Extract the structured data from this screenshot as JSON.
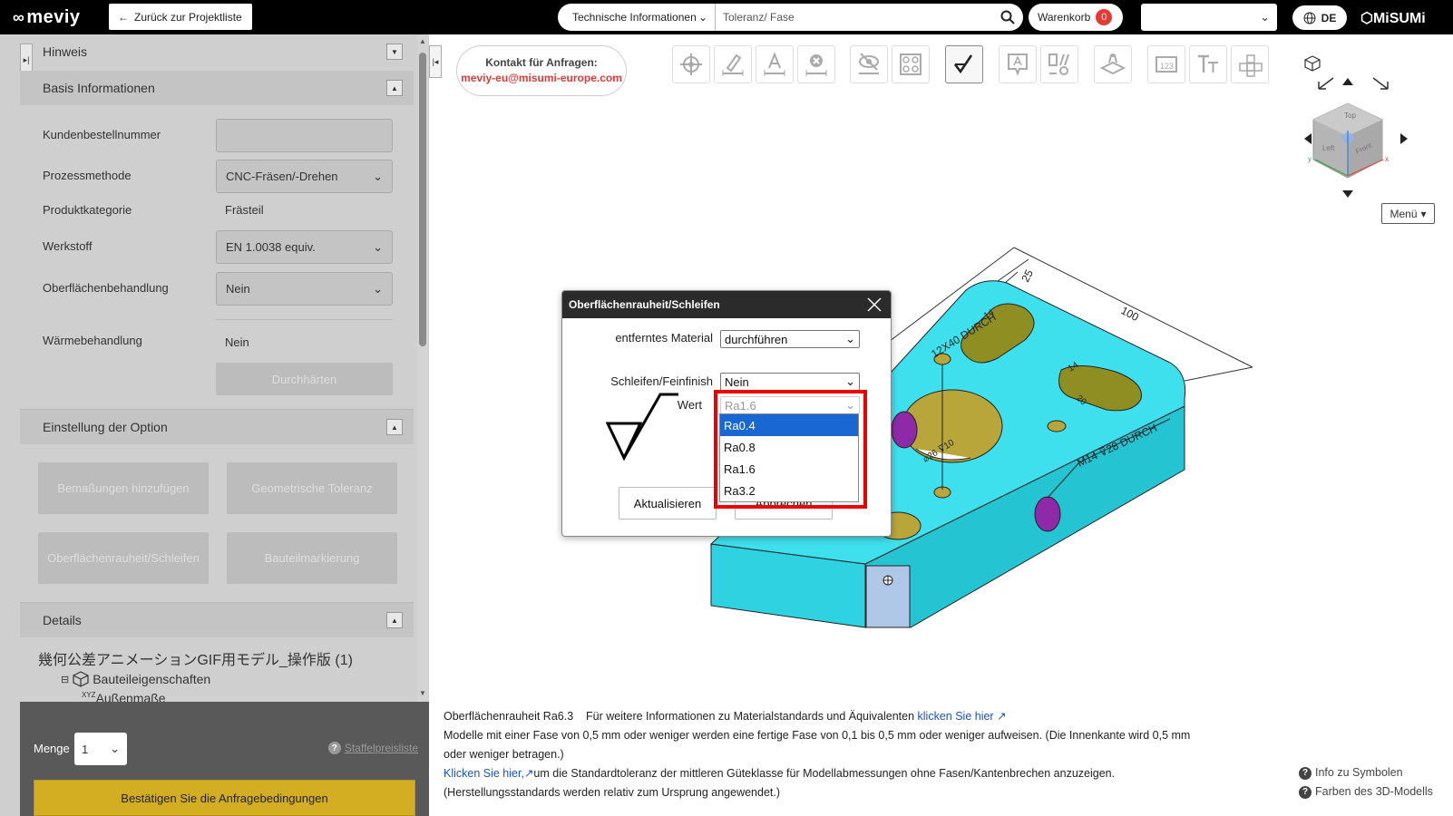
{
  "header": {
    "logo": "meviy",
    "back_label": "Zurück zur Projektliste",
    "tech_select": "Technische Informationen",
    "search_value": "Toleranz/ Fase",
    "cart_label": "Warenkorb",
    "cart_count": "0",
    "lang": "DE",
    "brand": "MiSUMi"
  },
  "sidebar": {
    "hinweis": "Hinweis",
    "basis": "Basis Informationen",
    "fields": {
      "kundenbestellnummer": "Kundenbestellnummer",
      "prozessmethode": "Prozessmethode",
      "prozessmethode_value": "CNC-Fräsen/-Drehen",
      "produktkategorie": "Produktkategorie",
      "produktkategorie_value": "Frästeil",
      "werkstoff": "Werkstoff",
      "werkstoff_value": "EN 1.0038 equiv.",
      "oberflaeche": "Oberflächenbehandlung",
      "oberflaeche_value": "Nein",
      "waerme": "Wärmebehandlung",
      "waerme_value": "Nein",
      "durchhaerten": "Durchhärten"
    },
    "option_title": "Einstellung der Option",
    "option_buttons": {
      "bemassungen": "Bemaßungen hinzufügen",
      "geo_toleranz": "Geometrische Toleranz",
      "oberflaechenrauheit": "Oberflächenrauheit/Schleifen",
      "bauteilmarkierung": "Bauteilmarkierung"
    },
    "details_title": "Details",
    "tree": {
      "model_name": "幾何公差アニメーションGIF用モデル_操作版 (1)",
      "node": "Bauteileigenschaften",
      "sub": "Außenmaße",
      "xyz": "XYZ"
    },
    "bottom": {
      "menge_label": "Menge",
      "menge_value": "1",
      "staffel": "Staffelpreisliste",
      "confirm": "Bestätigen Sie die Anfragebedingungen"
    }
  },
  "contact": {
    "line1": "Kontakt für Anfragen:",
    "line2": "meviy-eu@misumi-europe.com"
  },
  "viewer": {
    "menu_label": "Menü",
    "cube_faces": {
      "top": "Top",
      "left": "Left",
      "front": "Front"
    },
    "dims": {
      "d100": "100",
      "d25": "25",
      "d14": "14",
      "d20": "20",
      "hole": "12X40 DURCH",
      "thread": "M14 ⊽28 DURCH",
      "cbore": "⌀26 ⊽10"
    }
  },
  "dialog": {
    "title": "Oberflächenrauheit/Schleifen",
    "material_label": "entferntes Material",
    "material_value": "durchführen",
    "schleifen_label": "Schleifen/Feinfinish",
    "schleifen_value": "Nein",
    "wert_label": "Wert",
    "wert_value": "Ra1.6",
    "options": [
      "Ra0.4",
      "Ra0.8",
      "Ra1.6",
      "Ra3.2"
    ],
    "update_btn": "Aktualisieren",
    "cancel_btn": "Abbrechen"
  },
  "footer": {
    "line1": "Oberflächenrauheit Ra6.3    Für weitere Informationen zu Materialstandards und Äquivalenten ",
    "link1": "klicken Sie hier",
    "line2": "Modelle mit einer Fase von 0,5 mm oder weniger werden eine fertige Fase von 0,1 bis 0,5 mm oder weniger aufweisen. (Die Innenkante wird 0,5 mm oder weniger betragen.)",
    "link2": "Klicken Sie hier,",
    "line3": "um die Standardtoleranz der mittleren Güteklasse für Modellabmessungen ohne Fasen/Kantenbrechen anzuzeigen.",
    "line4": "(Herstellungsstandards werden relativ zum Ursprung angewendet.)",
    "info_symbols": "Info zu Symbolen",
    "colors_3d": "Farben des 3D-Modells"
  },
  "colors": {
    "accent_yellow": "#d4ae22",
    "model_cyan": "#3ee0ee",
    "model_olive": "#8e8e22",
    "highlight": "#e00000",
    "selected": "#1967d2"
  }
}
